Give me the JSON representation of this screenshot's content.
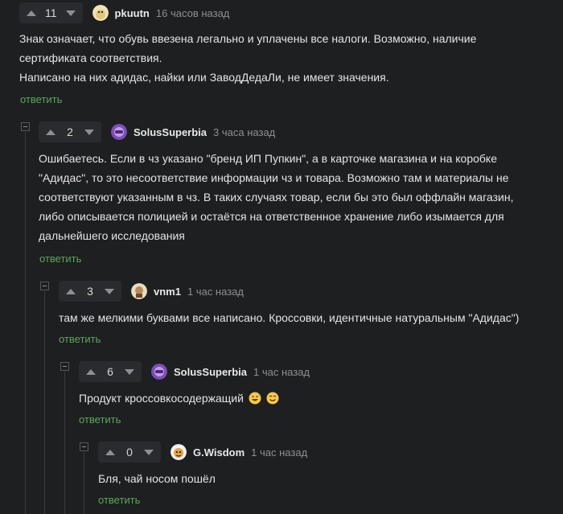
{
  "comments": [
    {
      "score": "11",
      "username": "pkuutn",
      "time": "16 часов назад",
      "lines": [
        "Знак означает, что обувь ввезена легально и уплачены все налоги. Возможно, наличие",
        "сертификата соответствия.",
        "Написано на них адидас, найки или ЗаводДедаЛи, не имеет значения."
      ],
      "reply": "ответить",
      "avatar_icon": "avatar-pkuutn-icon"
    },
    {
      "score": "2",
      "username": "SolusSuperbia",
      "time": "3 часа назад",
      "lines": [
        "Ошибаетесь. Если в чз указано \"бренд ИП Пупкин\", а в карточке магазина и на коробке",
        "\"Адидас\", то это несоответствие информации чз и товара. Возможно там и материалы не",
        "соответствуют указанным в чз. В таких случаях товар, если бы это был оффлайн магазин,",
        "либо описывается полицией и остаётся на ответственное хранение либо изымается для",
        "дальнейшего исследования"
      ],
      "reply": "ответить",
      "avatar_icon": "avatar-solussuperbia-icon"
    },
    {
      "score": "3",
      "username": "vnm1",
      "time": "1 час назад",
      "lines": [
        "там же мелкими буквами все написано. Кроссовки, идентичные натуральным \"Адидас\")"
      ],
      "reply": "ответить",
      "avatar_icon": "avatar-vnm1-icon"
    },
    {
      "score": "6",
      "username": "SolusSuperbia",
      "time": "1 час назад",
      "lines": [
        "Продукт кроссовкосодержащий"
      ],
      "reply": "ответить",
      "avatar_icon": "avatar-solussuperbia-icon",
      "emojis": [
        "grinning-sweat-emoji-icon",
        "smiling-emoji-icon"
      ]
    },
    {
      "score": "0",
      "username": "G.Wisdom",
      "time": "1 час назад",
      "lines": [
        "Бля, чай носом пошёл"
      ],
      "reply": "ответить",
      "avatar_icon": "avatar-gwisdom-icon"
    }
  ],
  "icons": {
    "upvote": "chevron-up-icon",
    "downvote": "chevron-down-icon",
    "collapse": "collapse-minus-icon"
  },
  "colors": {
    "background": "#1e1f21",
    "text": "#e4e4e4",
    "reply": "#59a85a",
    "muted": "#8e8f93"
  }
}
